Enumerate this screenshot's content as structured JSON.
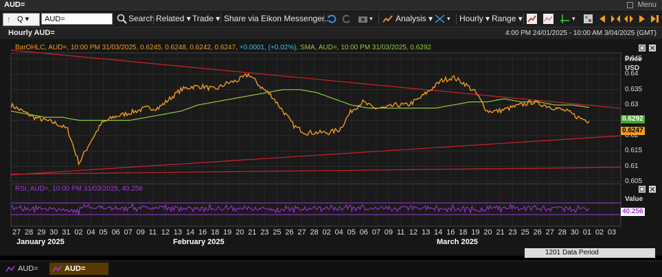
{
  "window": {
    "title": "AUD=",
    "menu_label": "Menu"
  },
  "toolbar": {
    "ric_value": "AUD=",
    "search_label": "Search",
    "related_label": "Related",
    "trade_label": "Trade",
    "share_label": "Share via Eikon Messenger...",
    "analysis_label": "Analysis",
    "interval_label": "Hourly",
    "range_label": "Range"
  },
  "chart_header": {
    "title": "Hourly AUD=",
    "date_range": "4:00 PM 24/01/2025 - 10:00 AM 3/04/2025 (GMT)"
  },
  "price_panel": {
    "legend_ohlc": "BarOHLC, AUD=, 10:00 PM 31/03/2025, 0.6245, 0.6248, 0.6242, 0.6247,",
    "legend_change": "+0.0001, (+0.02%),",
    "legend_sma": "SMA, AUD=, 10:00 PM 31/03/2025, 0.6292",
    "axis_title_1": "Price",
    "axis_title_2": "USD",
    "ticks": [
      "0.645",
      "0.64",
      "0.635",
      "0.63",
      "0.625",
      "0.62",
      "0.615",
      "0.61",
      "0.605"
    ],
    "sma_badge": "0.6292",
    "last_badge": "0.6247"
  },
  "rsi_panel": {
    "legend": "RSI, AUD=, 10:00 PM 31/03/2025, 40.256",
    "axis_title": "Value",
    "badge": "40.256"
  },
  "x_axis": {
    "days": [
      "27",
      "28",
      "29",
      "30",
      "31",
      "02",
      "04",
      "05",
      "06",
      "07",
      "09",
      "11",
      "12",
      "13",
      "14",
      "16",
      "18",
      "19",
      "20",
      "21",
      "23",
      "25",
      "26",
      "27",
      "28",
      "02",
      "04",
      "05",
      "06",
      "07",
      "09",
      "11",
      "12",
      "13",
      "14",
      "16",
      "18",
      "19",
      "20",
      "21",
      "23",
      "25",
      "26",
      "27",
      "28",
      "30",
      "01",
      "02",
      "03"
    ],
    "months": [
      "January 2025",
      "February 2025",
      "March 2025"
    ]
  },
  "status": {
    "data_period": "1201 Data Period",
    "tab1": "AUD=",
    "tab2": "AUD="
  },
  "colors": {
    "price": "#f39c1e",
    "sma": "#8fcc3a",
    "trend": "#d0202a",
    "rsi": "#a13ad8",
    "last_badge": "#f39c1e",
    "sma_badge": "#44a82e"
  },
  "chart_data": {
    "type": "line",
    "ylabel": "Price USD",
    "ylim": [
      0.605,
      0.647
    ],
    "series": [
      {
        "name": "BarOHLC, AUD=",
        "values": [
          0.63,
          0.628,
          0.626,
          0.625,
          0.624,
          0.622,
          0.611,
          0.618,
          0.624,
          0.626,
          0.627,
          0.628,
          0.629,
          0.629,
          0.632,
          0.635,
          0.636,
          0.636,
          0.635,
          0.637,
          0.638,
          0.64,
          0.636,
          0.633,
          0.628,
          0.623,
          0.621,
          0.621,
          0.621,
          0.622,
          0.628,
          0.631,
          0.629,
          0.629,
          0.63,
          0.63,
          0.632,
          0.635,
          0.638,
          0.639,
          0.637,
          0.634,
          0.628,
          0.628,
          0.629,
          0.63,
          0.631,
          0.63,
          0.629,
          0.628,
          0.626,
          0.6247
        ]
      },
      {
        "name": "SMA, AUD=",
        "values": [
          0.628,
          0.627,
          0.626,
          0.626,
          0.625,
          0.625,
          0.625,
          0.625,
          0.626,
          0.627,
          0.628,
          0.63,
          0.631,
          0.632,
          0.633,
          0.634,
          0.635,
          0.635,
          0.634,
          0.632,
          0.63,
          0.629,
          0.629,
          0.629,
          0.629,
          0.629,
          0.63,
          0.631,
          0.631,
          0.632,
          0.631,
          0.631,
          0.63,
          0.63,
          0.6292
        ]
      }
    ]
  }
}
